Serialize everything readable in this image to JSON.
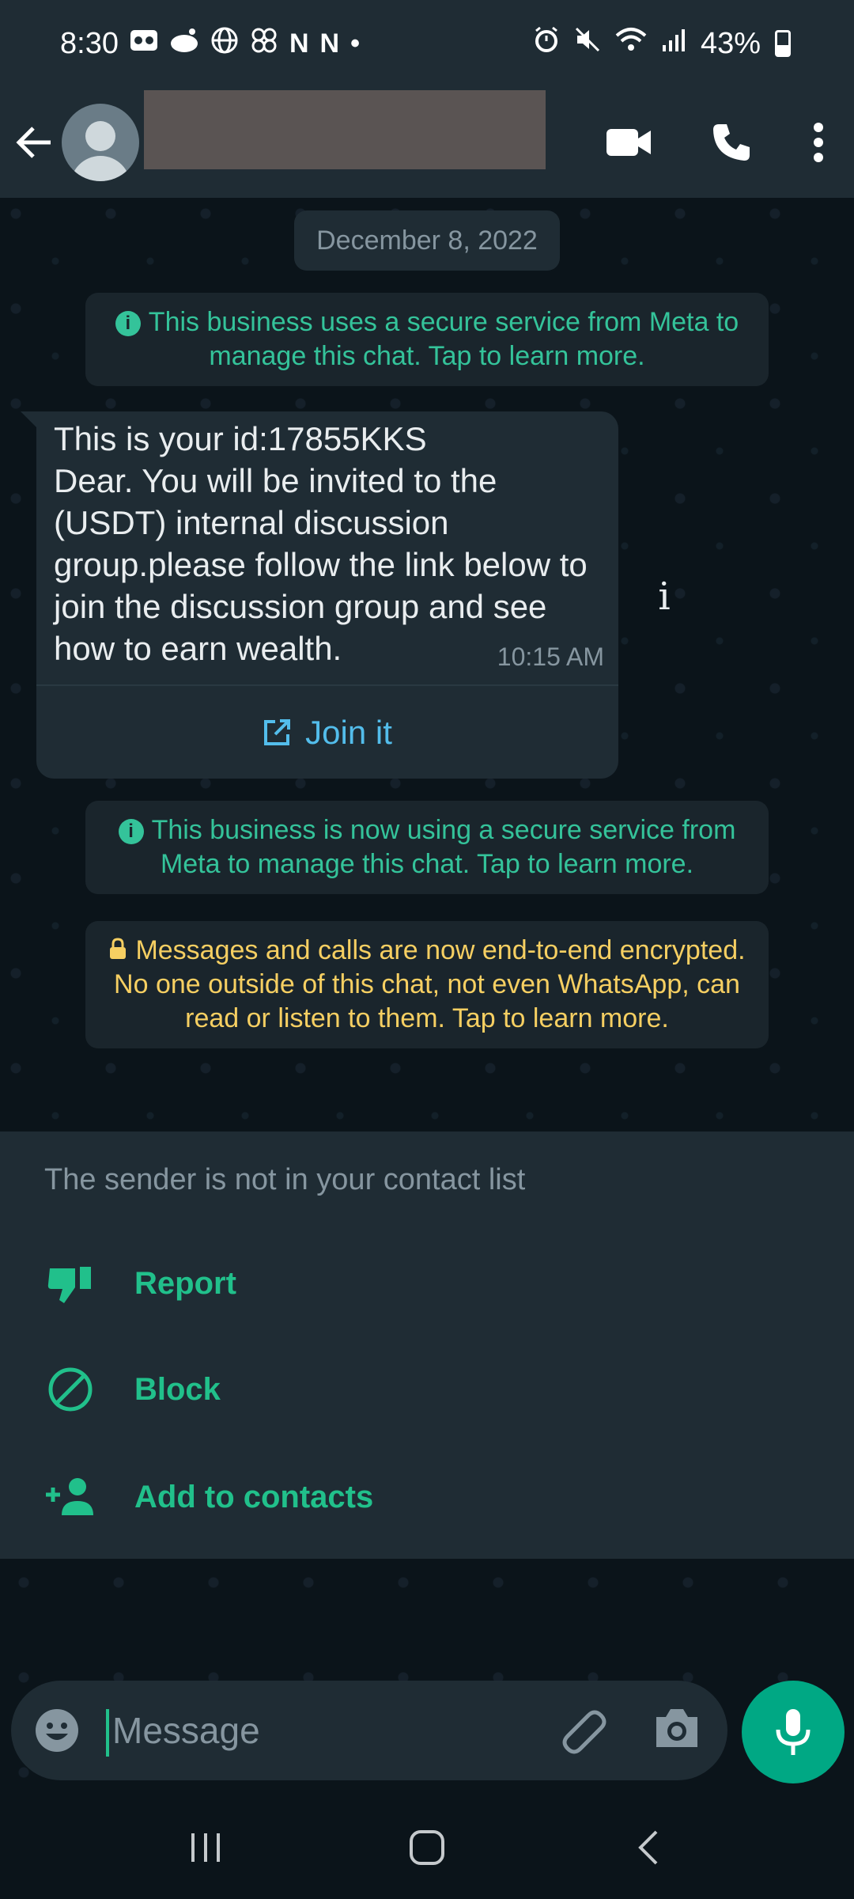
{
  "status_bar": {
    "time": "8:30",
    "battery": "43%",
    "left_icons": [
      "voicemail-icon",
      "reddit-icon",
      "globe-icon",
      "pinwheel-icon",
      "netflix-icon",
      "netflix-icon",
      "dot-icon"
    ],
    "right_icons": [
      "alarm-icon",
      "mute-icon",
      "wifi-icon",
      "signal-icon",
      "battery-icon"
    ]
  },
  "header": {
    "back_icon": "arrow-left-icon",
    "avatar_icon": "default-avatar-icon",
    "contact_name_redacted": true,
    "actions": [
      "video-call-icon",
      "voice-call-icon",
      "more-vert-icon"
    ]
  },
  "chat": {
    "date_chip": "December 8, 2022",
    "system_messages": [
      {
        "text": "This business uses a secure service from Meta to manage this chat. Tap to learn more.",
        "icon": "info-icon"
      },
      {
        "text": "This business is now using a secure service from Meta to manage this chat. Tap to learn more.",
        "icon": "info-icon"
      },
      {
        "text": "Messages and calls are now end-to-end encrypted. No one outside of this chat, not even WhatsApp, can read or listen to them. Tap to learn more.",
        "icon": "lock-icon"
      }
    ],
    "message": {
      "text": "This is your id:17855KKS\nDear. You will be invited to the (USDT) internal discussion group.please follow the link below to join the discussion group and see how to earn wealth.",
      "time": "10:15 AM",
      "button_label": "Join it",
      "button_icon": "open-external-icon"
    }
  },
  "unknown_sender": {
    "note": "The sender is not in your contact list",
    "actions": [
      {
        "label": "Report",
        "icon": "thumbs-down-icon"
      },
      {
        "label": "Block",
        "icon": "block-icon"
      },
      {
        "label": "Add to contacts",
        "icon": "add-person-icon"
      }
    ]
  },
  "composer": {
    "placeholder": "Message",
    "value": ""
  },
  "colors": {
    "accent": "#00a884",
    "link": "#53bdeb",
    "warning_text": "#f6cf62",
    "system_text": "#34c39a",
    "panel": "#1f2c34",
    "background": "#0b141a"
  }
}
